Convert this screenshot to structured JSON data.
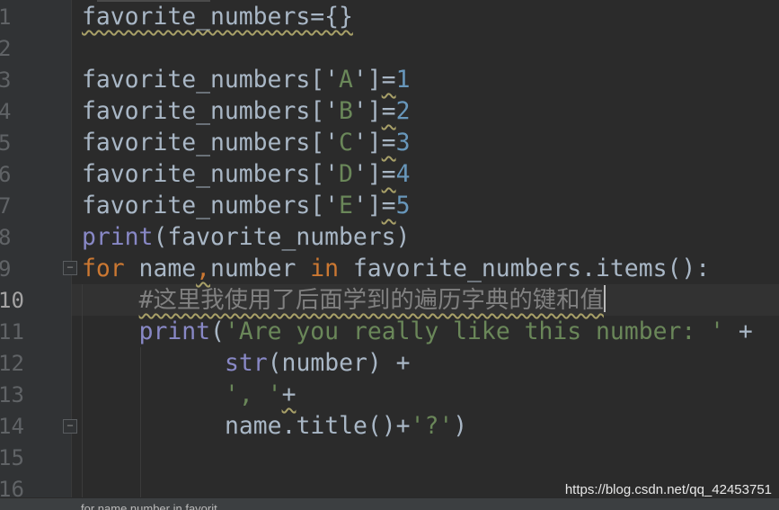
{
  "editor": {
    "current_line": 10,
    "line_numbers": [
      "1",
      "2",
      "3",
      "4",
      "5",
      "6",
      "7",
      "8",
      "9",
      "10",
      "11",
      "12",
      "13",
      "14",
      "15",
      "16"
    ],
    "lines": [
      {
        "indent": 0,
        "tokens": [
          {
            "t": "favorite_numbers={}",
            "c": "warn"
          }
        ]
      },
      {
        "indent": 0,
        "tokens": []
      },
      {
        "indent": 0,
        "tokens": [
          {
            "t": "favorite_numbers['",
            "c": ""
          },
          {
            "t": "A",
            "c": "str"
          },
          {
            "t": "']",
            "c": ""
          },
          {
            "t": "=",
            "c": "warn"
          },
          {
            "t": "1",
            "c": "num"
          }
        ]
      },
      {
        "indent": 0,
        "tokens": [
          {
            "t": "favorite_numbers['",
            "c": ""
          },
          {
            "t": "B",
            "c": "str"
          },
          {
            "t": "']",
            "c": ""
          },
          {
            "t": "=",
            "c": "warn"
          },
          {
            "t": "2",
            "c": "num"
          }
        ]
      },
      {
        "indent": 0,
        "tokens": [
          {
            "t": "favorite_numbers['",
            "c": ""
          },
          {
            "t": "C",
            "c": "str"
          },
          {
            "t": "']",
            "c": ""
          },
          {
            "t": "=",
            "c": "warn"
          },
          {
            "t": "3",
            "c": "num"
          }
        ]
      },
      {
        "indent": 0,
        "tokens": [
          {
            "t": "favorite_numbers['",
            "c": ""
          },
          {
            "t": "D",
            "c": "str"
          },
          {
            "t": "']",
            "c": ""
          },
          {
            "t": "=",
            "c": "warn"
          },
          {
            "t": "4",
            "c": "num"
          }
        ]
      },
      {
        "indent": 0,
        "tokens": [
          {
            "t": "favorite_numbers['",
            "c": ""
          },
          {
            "t": "E",
            "c": "str"
          },
          {
            "t": "']",
            "c": ""
          },
          {
            "t": "=",
            "c": "warn"
          },
          {
            "t": "5",
            "c": "num"
          }
        ]
      },
      {
        "indent": 0,
        "tokens": [
          {
            "t": "print",
            "c": "bi"
          },
          {
            "t": "(favorite_numbers)",
            "c": ""
          }
        ]
      },
      {
        "indent": 0,
        "tokens": [
          {
            "t": "for",
            "c": "kw"
          },
          {
            "t": " name",
            "c": ""
          },
          {
            "t": ",",
            "c": "kw warn"
          },
          {
            "t": "number ",
            "c": ""
          },
          {
            "t": "in",
            "c": "kw"
          },
          {
            "t": " favorite_numbers.items():",
            "c": ""
          }
        ]
      },
      {
        "indent": 4,
        "tokens": [
          {
            "t": "#这里我使用了后面学到的遍历字典的键和值",
            "c": "cm warn"
          }
        ],
        "caret": true
      },
      {
        "indent": 4,
        "tokens": [
          {
            "t": "print",
            "c": "bi"
          },
          {
            "t": "(",
            "c": ""
          },
          {
            "t": "'Are you really like this number: '",
            "c": "str"
          },
          {
            "t": " +",
            "c": ""
          }
        ]
      },
      {
        "indent": 10,
        "tokens": [
          {
            "t": "str",
            "c": "bi"
          },
          {
            "t": "(number) +",
            "c": ""
          }
        ]
      },
      {
        "indent": 10,
        "tokens": [
          {
            "t": "', '",
            "c": "str"
          },
          {
            "t": "+",
            "c": "warn"
          }
        ]
      },
      {
        "indent": 10,
        "tokens": [
          {
            "t": "name.title()+",
            "c": ""
          },
          {
            "t": "'?'",
            "c": "str"
          },
          {
            "t": ")",
            "c": ""
          }
        ]
      },
      {
        "indent": 0,
        "tokens": []
      },
      {
        "indent": 0,
        "tokens": []
      }
    ]
  },
  "breadcrumb": "for name,number in favorit...",
  "watermark": "https://blog.csdn.net/qq_42453751",
  "colors": {
    "background": "#2b2b2b",
    "keyword": "#cc7832",
    "number": "#6897bb",
    "string": "#6a8759",
    "builtin": "#8888c6",
    "comment": "#808080",
    "text": "#a9b7c6"
  }
}
